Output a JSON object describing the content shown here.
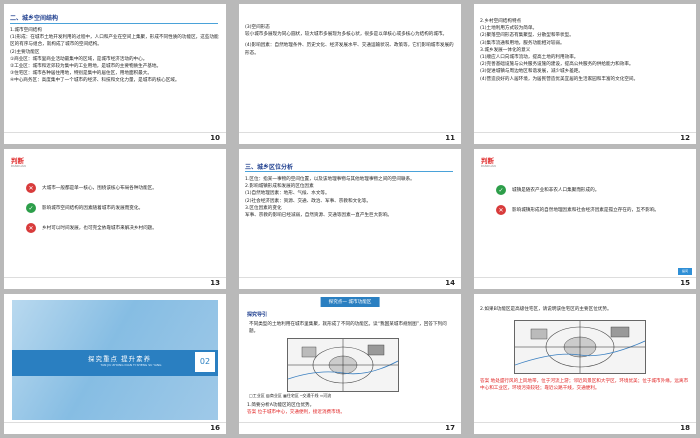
{
  "slides": [
    {
      "page": "10",
      "heading": "二、城乡空间结构",
      "lines": [
        "1.城市空间结构",
        "(1)形成：在城市土地开发利用的过程中，人口和产业在空间上集聚，形成不同性质的功能区，这些功能区的有序与组合，就构成了城市的空间结构。",
        "(2)主要功能区",
        "①商业区：城市里商业活动最集中的区域，是城市经济活动的中心。",
        "②工业区：城市和近郊较为集中的工业用地，是城市的主要物质生产基地。",
        "③住宅区：城市各种居住用地，特别是集中的居住区，用地面积最大。",
        "④中心商务区：高度集中了一个城市的经济、科技和文化力量，是城市的核心区域。"
      ]
    },
    {
      "page": "11",
      "lines": [
        "(3)空间形态",
        "较小城市多展现为同心圆状，较大城市多展现为多核心状，很多是以单核心或多核心为结构的城市。",
        "(4)影响因素：自然地理条件、历史文化、经济发展水平、交通运输状况、政策等，它们影响城市发展的形态。"
      ]
    },
    {
      "page": "12",
      "lines": [
        "2.乡村空间结构特点",
        "(1)土地利用方式较为简单。",
        "(2)聚落空间形态有集聚型、分散型和带状型。",
        "(3)集市流通和用地，服务功能相对较弱。",
        "3.城乡发展一体化的意义",
        "(1)顺应人口向城市流动，提高土地的利用效率。",
        "(2)完善基础设施与公共服务设施的建设，提高公共服务的供给能力和效率。",
        "(3)促进城镇与周边地区和谐发展，减少城乡差距。",
        "(4)营造良好的人居环境，为居民营造优美宜居的生活家园和丰富的文化空间。"
      ]
    },
    {
      "page": "13",
      "title": "判断",
      "subtitle": "PANDUAN",
      "items": [
        {
          "mark": "✕",
          "type": "no",
          "text": "大城市一般都是单一核心，围绕该核心布局各种功能区。"
        },
        {
          "mark": "✓",
          "type": "yes",
          "text": "影响城市空间结构的因素随着城市的发展而变化。"
        },
        {
          "mark": "✕",
          "type": "no",
          "text": "乡村可以时间发展，也可完全依靠城市来解决乡村问题。"
        }
      ]
    },
    {
      "page": "14",
      "heading": "三、城乡区位分析",
      "lines": [
        "1.区位：指某一事物的空间位置，以及该地理事物与其他地理事物之间的空间联系。",
        "2.影响城镇形成和发展的区位因素",
        "(1)自然地理因素：地形、气候、水文等。",
        "(2)社会经济因素：资源、交通、政治、军事、宗教和文化等。",
        "3.区位因素的变化",
        "军事、宗教的影响已经减弱，自然资源、交通等因素一直产生巨大影响。"
      ]
    },
    {
      "page": "15",
      "title": "判断",
      "subtitle": "PANDUAN",
      "button": "提问",
      "items": [
        {
          "mark": "✓",
          "type": "yes",
          "text": "城镇是随农产业和非农人口集聚而形成的。"
        },
        {
          "mark": "✕",
          "type": "no",
          "text": "影响城镇形成的自然地理因素和社会经济因素是孤立存在的，互不影响。"
        }
      ]
    },
    {
      "page": "16",
      "panel_title": "探究重点  提升素养",
      "panel_sub": "TAN JIU ZHONG DIAN  TI SHENG SU YANG",
      "panel_num": "02"
    },
    {
      "page": "17",
      "tab_title": "探究点一  城市功能区",
      "explore_label": "探究导引",
      "lines": [
        "不同类型的土地利用在城市里集聚，就形成了不同的功能区。读“我国某城市规划图”，回答下列问题。"
      ],
      "questions": [
        "1.简要分析A功能区的区位优势。",
        "答案  位于城市中心，交通便利，接近消费市场。"
      ],
      "legend": "□工业区 ▨商业区 ▦住宅区 ─交通干线 ≈河流"
    },
    {
      "page": "18",
      "lines": [
        "2.如果B功能区是高级住宅区，请说明该住宅区的主要区位优势。",
        "答案  地处盛行风的上风地带，位于河流上游；邻近风景区和大学区，环境优美；位于城市外缘，远离市中心和工业区，环境污染较轻；靠近公路干线，交通便利。"
      ]
    }
  ]
}
